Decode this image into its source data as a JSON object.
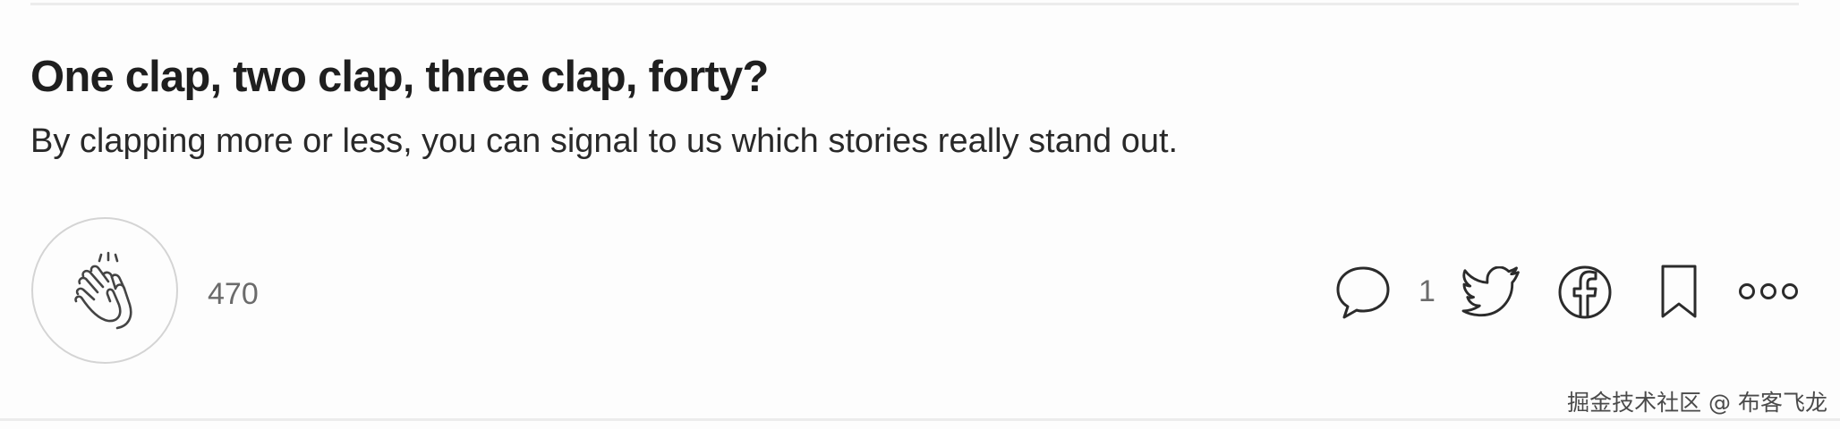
{
  "article": {
    "headline": "One clap, two clap, three clap, forty?",
    "subtext": "By clapping more or less, you can signal to us which stories really stand out."
  },
  "actions": {
    "clap": {
      "icon": "clap-hands-icon",
      "count": "470"
    },
    "comment": {
      "icon": "speech-bubble-icon",
      "count": "1"
    },
    "twitter": {
      "icon": "twitter-bird-icon"
    },
    "facebook": {
      "icon": "facebook-logo-icon"
    },
    "bookmark": {
      "icon": "bookmark-icon"
    },
    "more": {
      "icon": "more-dots-icon"
    }
  },
  "watermark": {
    "text": "掘金技术社区 @ 布客飞龙"
  }
}
